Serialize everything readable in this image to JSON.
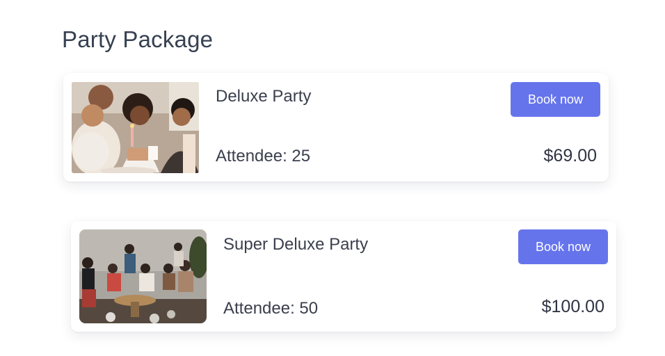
{
  "page": {
    "title": "Party Package"
  },
  "theme": {
    "accent": "#6674ec",
    "text": "#3a3f4d",
    "heading": "#364152"
  },
  "packages": [
    {
      "name": "Deluxe Party",
      "attendee_label": "Attendee: 25",
      "price": "$69.00",
      "button_label": "Book now",
      "image": "birthday-cake-candle-photo"
    },
    {
      "name": "Super Deluxe Party",
      "attendee_label": "Attendee: 50",
      "price": "$100.00",
      "button_label": "Book now",
      "image": "living-room-party-photo"
    }
  ]
}
